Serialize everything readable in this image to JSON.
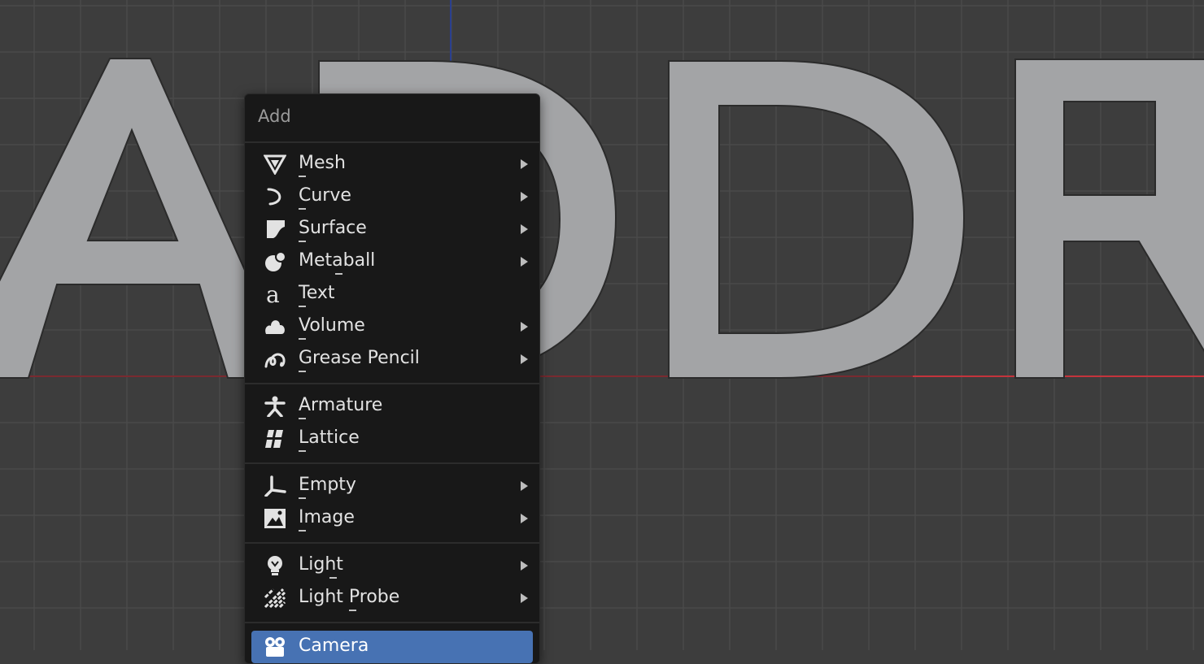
{
  "menu": {
    "title": "Add",
    "items": [
      {
        "label": "Mesh",
        "icon": "mesh-icon",
        "submenu": true
      },
      {
        "label": "Curve",
        "icon": "curve-icon",
        "submenu": true
      },
      {
        "label": "Surface",
        "icon": "surface-icon",
        "submenu": true
      },
      {
        "label": "Metaball",
        "icon": "metaball-icon",
        "submenu": true
      },
      {
        "label": "Text",
        "icon": "text-icon",
        "submenu": false
      },
      {
        "label": "Volume",
        "icon": "volume-icon",
        "submenu": true
      },
      {
        "label": "Grease Pencil",
        "icon": "grease-pencil-icon",
        "submenu": true
      },
      {
        "label": "Armature",
        "icon": "armature-icon",
        "submenu": false
      },
      {
        "label": "Lattice",
        "icon": "lattice-icon",
        "submenu": false
      },
      {
        "label": "Empty",
        "icon": "empty-icon",
        "submenu": true
      },
      {
        "label": "Image",
        "icon": "image-icon",
        "submenu": true
      },
      {
        "label": "Light",
        "icon": "light-icon",
        "submenu": true
      },
      {
        "label": "Light Probe",
        "icon": "light-probe-icon",
        "submenu": true
      },
      {
        "label": "Camera",
        "icon": "camera-icon",
        "submenu": false,
        "highlighted": true
      }
    ]
  },
  "viewport": {
    "text_object": "ADDR",
    "grid_color": "#4a4a4a",
    "background_color": "#3d3d3d",
    "object_color": "#a3a4a6",
    "x_axis_color": "#c4343c",
    "y_axis_color": "#2a3f8f"
  },
  "colors": {
    "menu_background": "#181818",
    "highlight": "#4772b3",
    "text": "#e2e2e2",
    "title_text": "#9a9a9a"
  }
}
